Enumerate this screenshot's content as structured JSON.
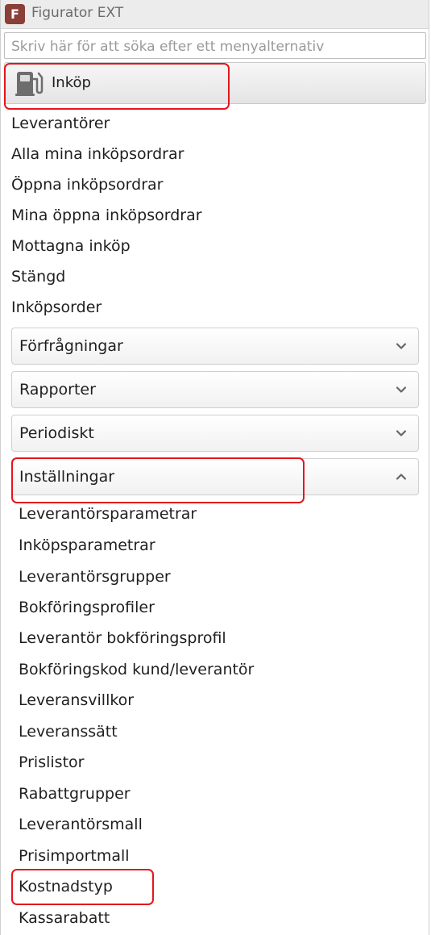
{
  "app": {
    "logo_letter": "F",
    "title": "Figurator EXT"
  },
  "search": {
    "placeholder": "Skriv här för att söka efter ett menyalternativ"
  },
  "module": {
    "label": "Inköp",
    "icon": "fuel-pump-icon"
  },
  "top_items": [
    "Leverantörer",
    "Alla mina inköpsordrar",
    "Öppna inköpsordrar",
    "Mina öppna inköpsordrar",
    "Mottagna inköp",
    "Stängd",
    "Inköpsorder"
  ],
  "groups": [
    {
      "label": "Förfrågningar",
      "state": "collapsed",
      "icon": "chevron-down-icon"
    },
    {
      "label": "Rapporter",
      "state": "collapsed",
      "icon": "chevron-down-icon"
    },
    {
      "label": "Periodiskt",
      "state": "collapsed",
      "icon": "chevron-down-icon"
    },
    {
      "label": "Inställningar",
      "state": "expanded",
      "icon": "chevron-up-icon"
    }
  ],
  "settings_items": [
    "Leverantörsparametrar",
    "Inköpsparametrar",
    "Leverantörsgrupper",
    "Bokföringsprofiler",
    "Leverantör bokföringsprofil",
    "Bokföringskod kund/leverantör",
    "Leveransvillkor",
    "Leveranssätt",
    "Prislistor",
    "Rabattgrupper",
    "Leverantörsmall",
    "Prisimportmall",
    "Kostnadstyp",
    "Kassarabatt"
  ],
  "colors": {
    "logo": "#8a3f37",
    "highlight": "#e4161b"
  }
}
